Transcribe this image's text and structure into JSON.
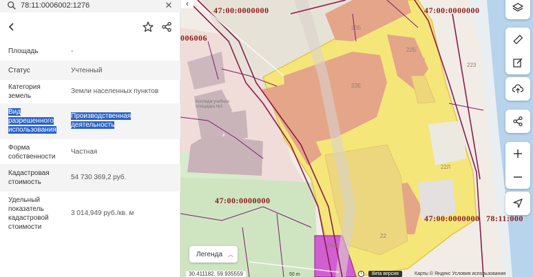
{
  "search": {
    "query": "78:11:0006002:1276"
  },
  "properties": [
    {
      "label": "Площадь",
      "value": "-"
    },
    {
      "label": "Статус",
      "value": "Учтенный"
    },
    {
      "label": "Категория земель",
      "value": "Земли населенных пунктов"
    },
    {
      "label": "Вид разрешенного использования",
      "value": "Производственная деятельность"
    },
    {
      "label": "Форма собственности",
      "value": "Частная"
    },
    {
      "label": "Кадастровая стоимость",
      "value": "54 730 369,2 руб."
    },
    {
      "label": "Удельный показатель кадастровой стоимости",
      "value": "3 014,949 руб./кв. м"
    }
  ],
  "map": {
    "quarter_labels": [
      "47:00:0000000",
      "47:00:0000000",
      "47:00:0000000",
      "47:00:0000000",
      "78:11:000"
    ],
    "partial_label": "006006",
    "building_numbers": [
      "22Б",
      "22Е",
      "22Б",
      "223",
      "22Л",
      "22",
      "24к2"
    ],
    "school_label": "Колледж учебная площадка №1",
    "legend_label": "Легенда",
    "coordinates": "30.411182, 59.935559",
    "scale": "50 m",
    "beta_label": "Beta версия",
    "attribution": "Карты © Яндекс   Условия использования",
    "colors": {
      "parcel": "#f5e67a",
      "building": "#e4a589",
      "boundary": "#8b1a4a",
      "water": "#b7d4ec",
      "park": "#cfe5c2",
      "selected": "#d15fd1"
    }
  }
}
